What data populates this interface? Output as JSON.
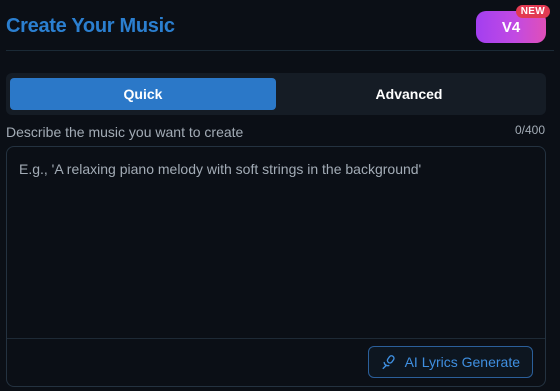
{
  "header": {
    "title": "Create Your Music",
    "version_label": "V4",
    "badge": "NEW"
  },
  "tabs": [
    {
      "label": "Quick",
      "active": true
    },
    {
      "label": "Advanced",
      "active": false
    }
  ],
  "prompt": {
    "label": "Describe the music you want to create",
    "char_count": "0/400",
    "value": "",
    "placeholder": "E.g., 'A relaxing piano melody with soft strings in the background'"
  },
  "lyrics_button": {
    "label": "AI Lyrics Generate",
    "icon": "microphone-icon"
  },
  "colors": {
    "background": "#0b0f16",
    "title": "#2b7fd0",
    "accent": "#2b78c8",
    "badge": "#e23a52",
    "version_gradient_start": "#a33ff0",
    "version_gradient_end": "#e04fb8"
  }
}
